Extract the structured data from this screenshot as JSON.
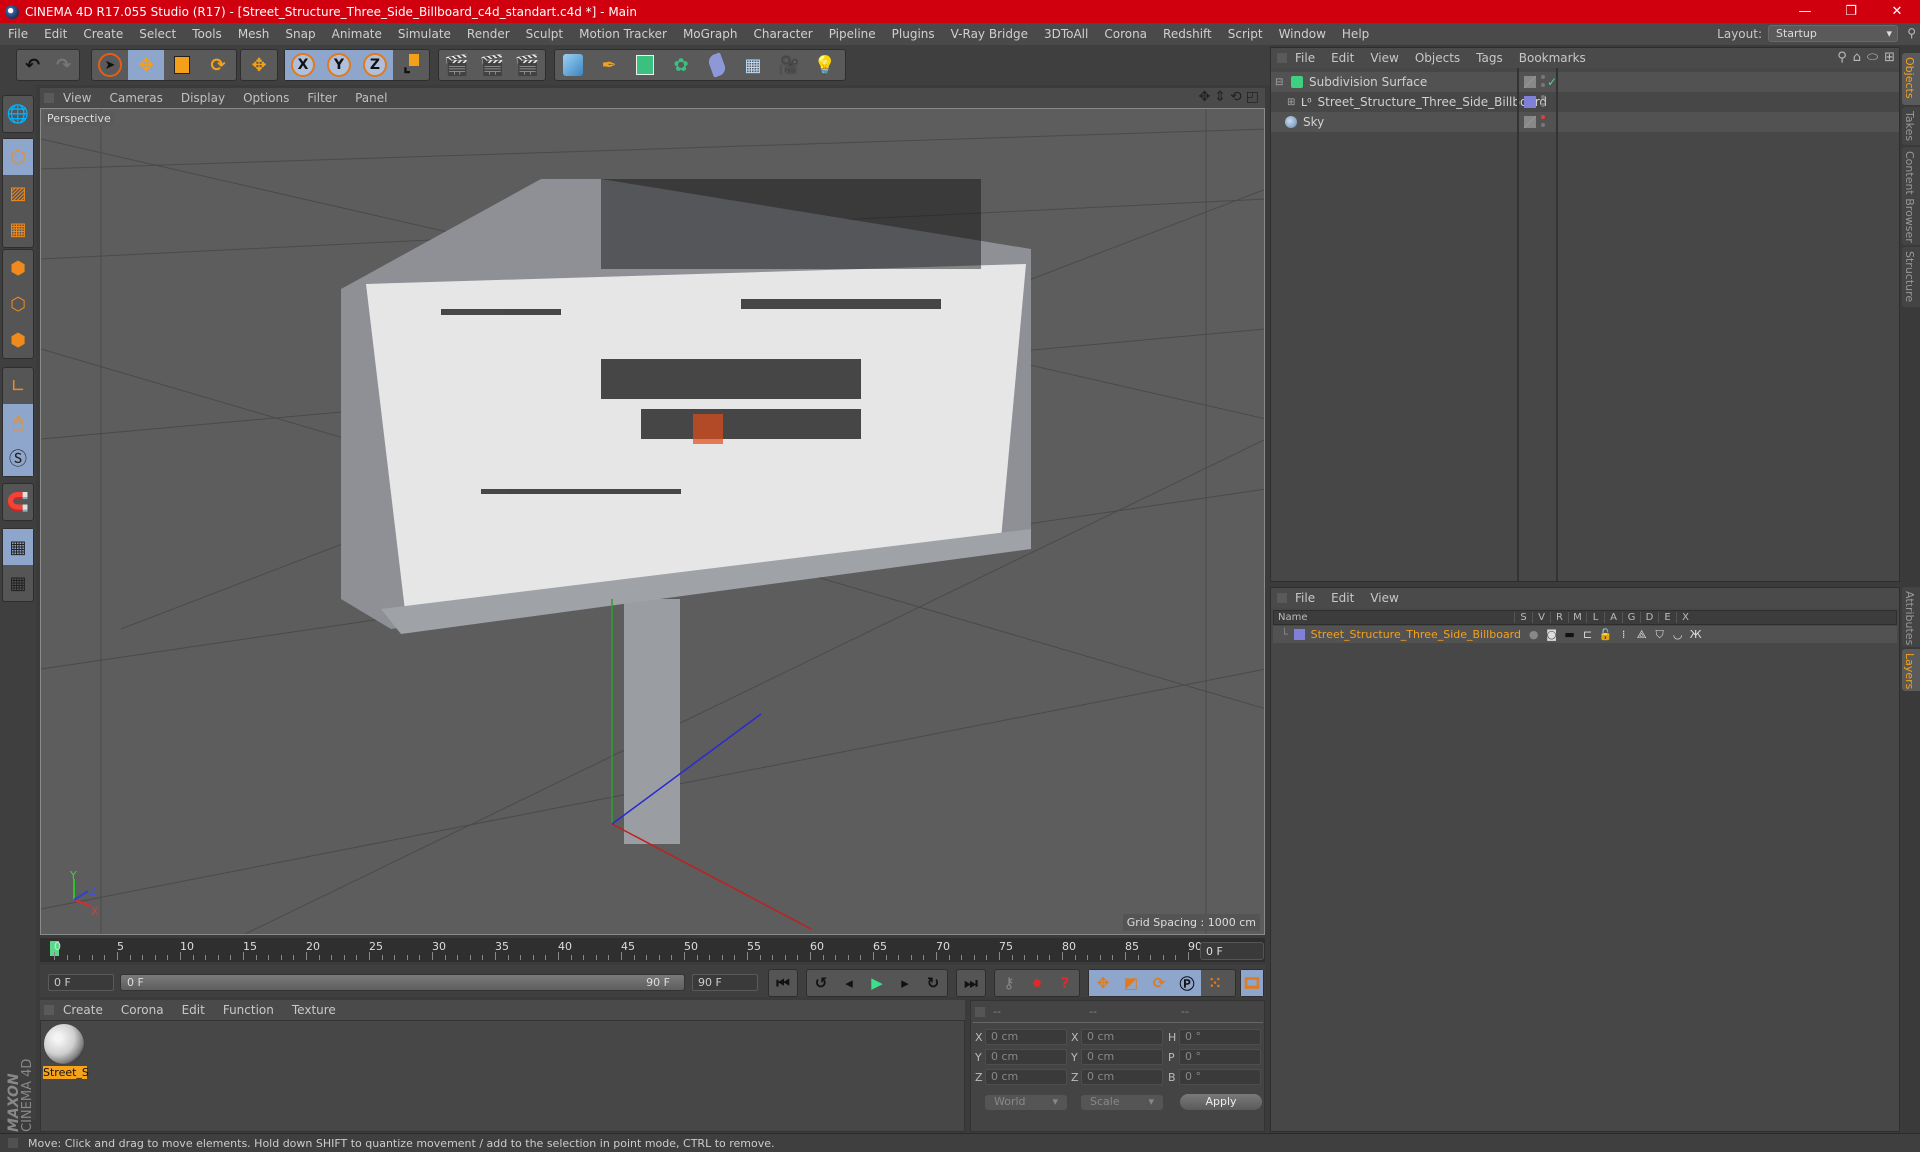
{
  "titlebar": {
    "title": "CINEMA 4D R17.055 Studio (R17) - [Street_Structure_Three_Side_Billboard_c4d_standart.c4d *] - Main",
    "minimize": "—",
    "restore": "❐",
    "close": "✕"
  },
  "menubar": {
    "items": [
      "File",
      "Edit",
      "Create",
      "Select",
      "Tools",
      "Mesh",
      "Snap",
      "Animate",
      "Simulate",
      "Render",
      "Sculpt",
      "Motion Tracker",
      "MoGraph",
      "Character",
      "Pipeline",
      "Plugins",
      "V-Ray Bridge",
      "3DToAll",
      "Corona",
      "Redshift",
      "Script",
      "Window",
      "Help"
    ],
    "layout_label": "Layout:",
    "layout_value": "Startup"
  },
  "toolbar": {
    "undo": "undo-icon",
    "redo": "redo-icon",
    "tools": [
      "select-pointer-icon",
      "move-icon",
      "scale-icon",
      "rotate-icon",
      "live-selection-icon"
    ],
    "axes": [
      "X",
      "Y",
      "Z"
    ],
    "coord_system": "world-coordinate-icon",
    "render": [
      "render-view-icon",
      "render-picture-viewer-icon",
      "render-settings-icon"
    ],
    "objects": [
      "cube-icon",
      "pen-spline-icon",
      "subdivision-icon",
      "cloner-icon",
      "deformer-icon",
      "floor-icon",
      "camera-icon",
      "light-icon"
    ]
  },
  "leftbar": {
    "modes": [
      "make-editable-icon",
      "model-mode-icon",
      "texture-mode-icon",
      "workplane-mode-icon",
      "points-mode-icon",
      "edges-mode-icon",
      "polygons-mode-icon",
      "axis-mode-icon",
      "tweak-mode-icon",
      "snap-icon",
      "magnet-icon",
      "lock-workplane-icon",
      "workplane-align-icon"
    ]
  },
  "viewport": {
    "menu": [
      "View",
      "Cameras",
      "Display",
      "Options",
      "Filter",
      "Panel"
    ],
    "label": "Perspective",
    "grid_spacing": "Grid Spacing : 1000 cm",
    "axis_labels": [
      "X",
      "Y",
      "Z"
    ]
  },
  "timeline": {
    "ticks": [
      "0",
      "5",
      "10",
      "15",
      "20",
      "25",
      "30",
      "35",
      "40",
      "45",
      "50",
      "55",
      "60",
      "65",
      "70",
      "75",
      "80",
      "85",
      "90"
    ],
    "current_frame": "0 F",
    "start_field": "0 F",
    "range_start": "0 F",
    "range_end": "90 F",
    "end_field": "90 F"
  },
  "materials": {
    "menu": [
      "Create",
      "Corona",
      "Edit",
      "Function",
      "Texture"
    ],
    "items": [
      {
        "name": "Street_S"
      }
    ],
    "brand_top": "MAXON",
    "brand_bottom": "CINEMA 4D"
  },
  "coordinates": {
    "headers": [
      "--",
      "--",
      "--"
    ],
    "rows": [
      {
        "pos_label": "X",
        "pos": "0 cm",
        "size_label": "X",
        "size": "0 cm",
        "rot_label": "H",
        "rot": "0 °"
      },
      {
        "pos_label": "Y",
        "pos": "0 cm",
        "size_label": "Y",
        "size": "0 cm",
        "rot_label": "P",
        "rot": "0 °"
      },
      {
        "pos_label": "Z",
        "pos": "0 cm",
        "size_label": "Z",
        "size": "0 cm",
        "rot_label": "B",
        "rot": "0 °"
      }
    ],
    "mode": "World",
    "transform": "Scale",
    "apply": "Apply"
  },
  "objects_panel": {
    "menu": [
      "File",
      "Edit",
      "View",
      "Objects",
      "Tags",
      "Bookmarks"
    ],
    "items": [
      {
        "name": "Subdivision Surface",
        "icon": "subdivision-surface-icon",
        "expanded": true,
        "enabled": true
      },
      {
        "name": "Street_Structure_Three_Side_Billboard",
        "icon": "null-object-icon",
        "expanded": false,
        "layer_color": "#8080d8"
      },
      {
        "name": "Sky",
        "icon": "sky-icon",
        "render_off": true
      }
    ]
  },
  "layers_panel": {
    "menu": [
      "File",
      "Edit",
      "View"
    ],
    "columns": [
      "Name",
      "S",
      "V",
      "R",
      "M",
      "L",
      "A",
      "G",
      "D",
      "E",
      "X"
    ],
    "rows": [
      {
        "name": "Street_Structure_Three_Side_Billboard",
        "color": "#8080d8"
      }
    ]
  },
  "right_tabs": [
    "Objects",
    "Takes",
    "Content Browser",
    "Structure",
    "Attributes",
    "Layers"
  ],
  "status": {
    "text": "Move: Click and drag to move elements. Hold down SHIFT to quantize movement / add to the selection in point mode, CTRL to remove."
  },
  "colors": {
    "title_red": "#d0000f",
    "accent_orange": "#f4a11a",
    "selected_blue": "#8fa6cc"
  }
}
